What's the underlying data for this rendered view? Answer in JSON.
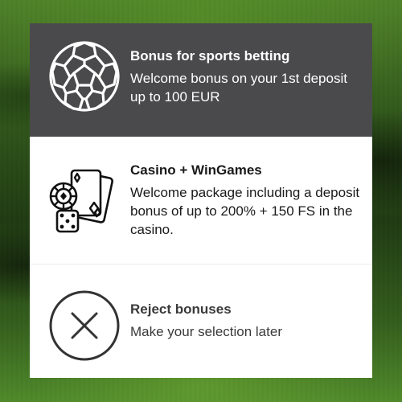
{
  "bonus_dialog": {
    "options": [
      {
        "id": "sports",
        "icon": "soccer-ball-icon",
        "title": "Bonus for sports betting",
        "description": "Welcome bonus on your 1st deposit up to 100 EUR",
        "selected": true
      },
      {
        "id": "casino",
        "icon": "casino-cards-dice-icon",
        "title": "Casino + WinGames",
        "description": "Welcome package including a deposit bonus of up to 200% + 150 FS in the casino.",
        "selected": false
      },
      {
        "id": "reject",
        "icon": "close-circle-icon",
        "title": "Reject bonuses",
        "description": "Make your selection later",
        "selected": false
      }
    ]
  },
  "colors": {
    "selected_background": "#4a4a4c",
    "card_background": "#ffffff",
    "selected_text": "#ffffff",
    "body_text": "#1a1a1a"
  }
}
